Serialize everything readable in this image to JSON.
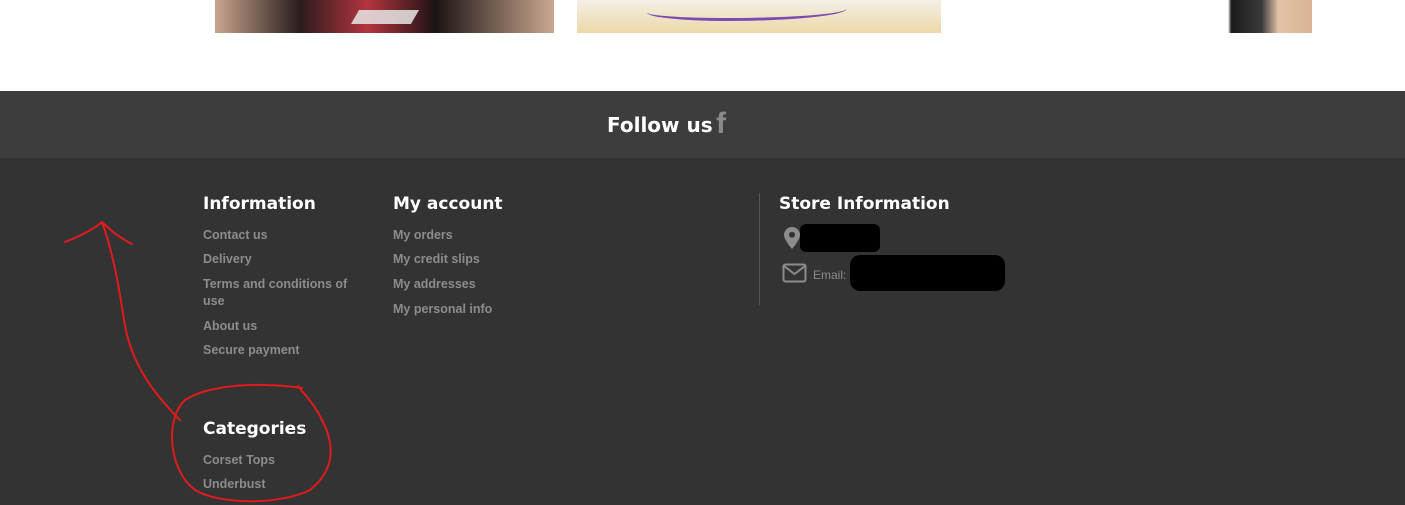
{
  "follow": {
    "label": "Follow us"
  },
  "information": {
    "title": "Information",
    "links": [
      "Contact us",
      "Delivery",
      "Terms and conditions of use",
      "About us",
      "Secure payment"
    ]
  },
  "my_account": {
    "title": "My account",
    "links": [
      "My orders",
      "My credit slips",
      "My addresses",
      "My personal info"
    ]
  },
  "store_info": {
    "title": "Store Information",
    "email_label": "Email:"
  },
  "categories": {
    "title": "Categories",
    "links": [
      "Corset Tops",
      "Underbust"
    ]
  },
  "icons": {
    "social": "facebook-icon",
    "address": "map-pin-icon",
    "email": "envelope-icon"
  },
  "colors": {
    "follow_bar": "#3d3d3d",
    "footer_bg": "#333333",
    "link": "#8c8c8c",
    "annotation": "#e01b1b"
  }
}
